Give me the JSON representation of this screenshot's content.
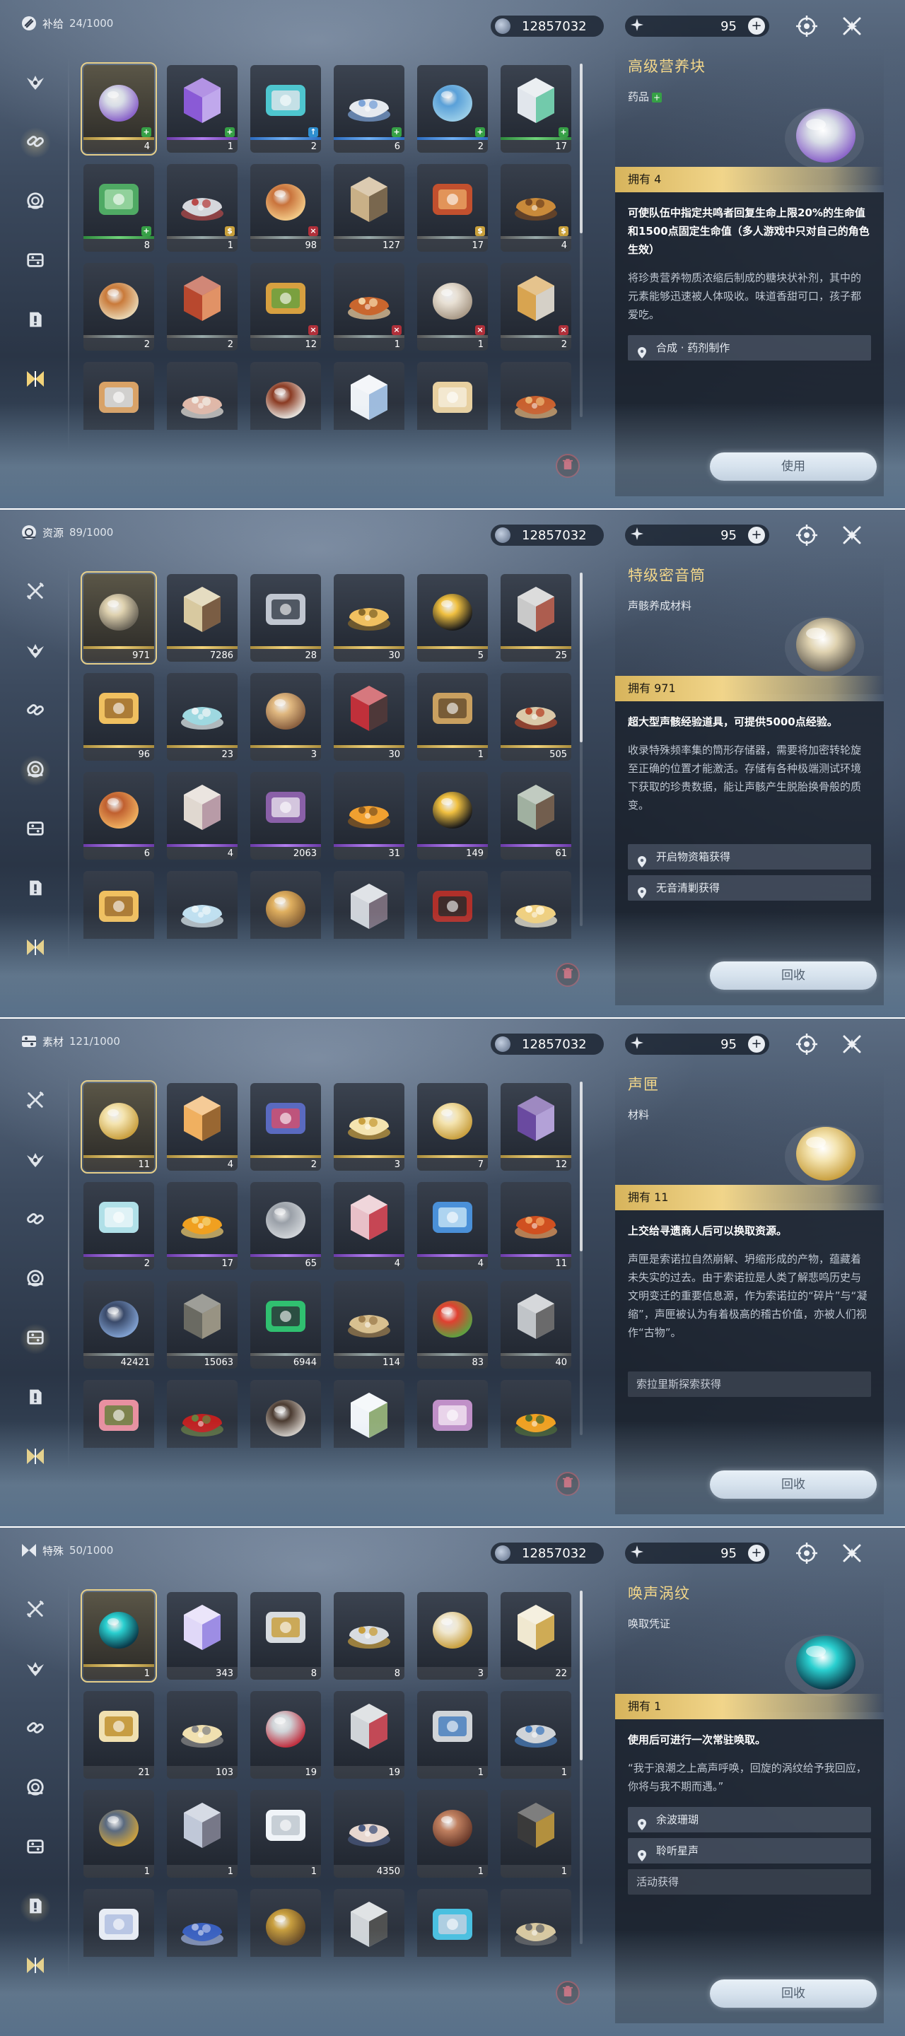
{
  "currency": {
    "coins": "12857032",
    "energy": "95",
    "plus": "+"
  },
  "panels": [
    {
      "category": "补给",
      "count": "24/1000",
      "active_tab": 2,
      "detail": {
        "name": "高级营养块",
        "type": "药品",
        "type_badge": "+",
        "owned": "拥有 4",
        "effect": "可使队伍中指定共鸣者回复生命上限20%的生命值和1500点固定生命值（多人游戏中只对自己的角色生效）",
        "lore": "将珍贵营养物质浓缩后制成的糖块状补剂，其中的元素能够迅速被人体吸收。味道香甜可口，孩子都爱吃。",
        "sources": [
          "合成 · 药剂制作"
        ],
        "plain_sources": [],
        "action": "使用"
      },
      "items": [
        {
          "qty": "4",
          "bar": "gold",
          "badge": "plus",
          "sel": true,
          "c1": "#d8dde6",
          "c2": "#8a63c9"
        },
        {
          "qty": "1",
          "bar": "purple",
          "badge": "plus",
          "c1": "#8a5ad6",
          "c2": "#c9b6f0"
        },
        {
          "qty": "2",
          "bar": "blue",
          "badge": "up",
          "c1": "#4ec6cf",
          "c2": "#d9e4ea"
        },
        {
          "qty": "6",
          "bar": "blue",
          "badge": "plus",
          "c1": "#e5e9ef",
          "c2": "#7da4d8"
        },
        {
          "qty": "2",
          "bar": "blue",
          "badge": "plus",
          "c1": "#5aa0d8",
          "c2": "#99cde8"
        },
        {
          "qty": "17",
          "bar": "green",
          "badge": "plus",
          "c1": "#e1e6ec",
          "c2": "#5ec4a0"
        },
        {
          "qty": "8",
          "bar": "green",
          "badge": "plus",
          "c1": "#4faa64",
          "c2": "#9cd8a4"
        },
        {
          "qty": "1",
          "bar": "gray",
          "badge": "gold",
          "c1": "#d5d7dc",
          "c2": "#b84a4a"
        },
        {
          "qty": "98",
          "bar": "gray",
          "badge": "x",
          "c1": "#c9733c",
          "c2": "#f2c886"
        },
        {
          "qty": "127",
          "bar": "gray",
          "badge": "",
          "c1": "#c9b087",
          "c2": "#6b5a44"
        },
        {
          "qty": "17",
          "bar": "gray",
          "badge": "gold",
          "c1": "#c2502e",
          "c2": "#e8a060"
        },
        {
          "qty": "4",
          "bar": "gray",
          "badge": "gold",
          "c1": "#c98a3a",
          "c2": "#7a4a22"
        },
        {
          "qty": "2",
          "bar": "gray",
          "badge": "",
          "c1": "#c97a3a",
          "c2": "#e8d4b0"
        },
        {
          "qty": "2",
          "bar": "gray",
          "badge": "",
          "c1": "#b8482e",
          "c2": "#e8a070"
        },
        {
          "qty": "12",
          "bar": "gray",
          "badge": "x",
          "c1": "#d7a040",
          "c2": "#6aa040"
        },
        {
          "qty": "1",
          "bar": "gray",
          "badge": "x",
          "c1": "#c9662e",
          "c2": "#f2d0a0"
        },
        {
          "qty": "1",
          "bar": "gray",
          "badge": "x",
          "c1": "#e8e0d4",
          "c2": "#a99a88"
        },
        {
          "qty": "2",
          "bar": "gray",
          "badge": "x",
          "c1": "#d8a450",
          "c2": "#d5d8dc"
        },
        {
          "qty": "",
          "bar": "",
          "badge": "",
          "c1": "#d9a266",
          "c2": "#cfd8e0"
        },
        {
          "qty": "",
          "bar": "",
          "badge": "",
          "c1": "#e0b8a8",
          "c2": "#f0e8e0"
        },
        {
          "qty": "",
          "bar": "",
          "badge": "",
          "c1": "#8a3a22",
          "c2": "#e8e0d8"
        },
        {
          "qty": "",
          "bar": "",
          "badge": "",
          "c1": "#eef2f6",
          "c2": "#8fb2d8"
        },
        {
          "qty": "",
          "bar": "",
          "badge": "",
          "c1": "#e8d0a0",
          "c2": "#f4ecd8"
        },
        {
          "qty": "",
          "bar": "",
          "badge": "",
          "c1": "#c9602e",
          "c2": "#e8b070"
        }
      ]
    },
    {
      "category": "资源",
      "count": "89/1000",
      "active_tab": 3,
      "detail": {
        "name": "特级密音筒",
        "type": "声骸养成材料",
        "type_badge": "",
        "owned": "拥有 971",
        "effect": "超大型声骸经验道具，可提供5000点经验。",
        "lore": "收录特殊频率集的筒形存储器，需要将加密转轮旋至正确的位置才能激活。存储有各种极端测试环境下获取的珍贵数据，能让声骸产生脱胎换骨般的质变。",
        "sources": [
          "开启物资箱获得",
          "无音清剿获得"
        ],
        "plain_sources": [],
        "action": "回收"
      },
      "items": [
        {
          "qty": "971",
          "bar": "gold",
          "badge": "",
          "sel": true,
          "c1": "#dfd2b0",
          "c2": "#6a6458"
        },
        {
          "qty": "7286",
          "bar": "gold",
          "badge": "",
          "c1": "#d8c9a0",
          "c2": "#6a4a34"
        },
        {
          "qty": "28",
          "bar": "gold",
          "badge": "",
          "c1": "#c0c6d0",
          "c2": "#3c4450"
        },
        {
          "qty": "30",
          "bar": "gold",
          "badge": "",
          "c1": "#f0c060",
          "c2": "#8a6a2a"
        },
        {
          "qty": "5",
          "bar": "gold",
          "badge": "",
          "c1": "#f0c040",
          "c2": "#1a1a1a"
        },
        {
          "qty": "25",
          "bar": "gold",
          "badge": "",
          "c1": "#c9c9c9",
          "c2": "#a84a3a"
        },
        {
          "qty": "96",
          "bar": "gold",
          "badge": "",
          "c1": "#f0c060",
          "c2": "#a07030"
        },
        {
          "qty": "23",
          "bar": "gold",
          "badge": "",
          "c1": "#9ed8e0",
          "c2": "#e8f2f4"
        },
        {
          "qty": "3",
          "bar": "gold",
          "badge": "",
          "c1": "#e0b880",
          "c2": "#8a6040"
        },
        {
          "qty": "30",
          "bar": "gold",
          "badge": "",
          "c1": "#c0303a",
          "c2": "#3a3a3a"
        },
        {
          "qty": "1",
          "bar": "gold",
          "badge": "",
          "c1": "#c9a060",
          "c2": "#6a5030"
        },
        {
          "qty": "505",
          "bar": "gold",
          "badge": "",
          "c1": "#dac8a8",
          "c2": "#b84a2e"
        },
        {
          "qty": "6",
          "bar": "purple",
          "badge": "",
          "c1": "#c06030",
          "c2": "#f0b060"
        },
        {
          "qty": "4",
          "bar": "purple",
          "badge": "",
          "c1": "#e0d8d0",
          "c2": "#b090a0"
        },
        {
          "qty": "2063",
          "bar": "purple",
          "badge": "",
          "c1": "#8a60a8",
          "c2": "#e0d8e8"
        },
        {
          "qty": "31",
          "bar": "purple",
          "badge": "",
          "c1": "#f0a030",
          "c2": "#8a5a20"
        },
        {
          "qty": "149",
          "bar": "purple",
          "badge": "",
          "c1": "#f0c040",
          "c2": "#1a1a1a"
        },
        {
          "qty": "61",
          "bar": "purple",
          "badge": "",
          "c1": "#a0b0a0",
          "c2": "#6a5040"
        },
        {
          "qty": "",
          "bar": "",
          "badge": "",
          "c1": "#f0c060",
          "c2": "#a07030"
        },
        {
          "qty": "",
          "bar": "",
          "badge": "",
          "c1": "#c0e0f0",
          "c2": "#e8f4f8"
        },
        {
          "qty": "",
          "bar": "",
          "badge": "",
          "c1": "#e0b060",
          "c2": "#8a6030"
        },
        {
          "qty": "",
          "bar": "",
          "badge": "",
          "c1": "#d0d4da",
          "c2": "#6a5a6a"
        },
        {
          "qty": "",
          "bar": "",
          "badge": "",
          "c1": "#b0302a",
          "c2": "#2a2a2a"
        },
        {
          "qty": "",
          "bar": "",
          "badge": "",
          "c1": "#f0d080",
          "c2": "#fff8e0"
        }
      ]
    },
    {
      "category": "素材",
      "count": "121/1000",
      "active_tab": 4,
      "detail": {
        "name": "声匣",
        "type": "材料",
        "type_badge": "",
        "owned": "拥有 11",
        "effect": "上交给寻遗商人后可以换取资源。",
        "lore": "声匣是索诺拉自然崩解、坍缩形成的产物，蕴藏着未失实的过去。由于索诺拉是人类了解悲鸣历史与文明变迁的重要信息源，作为索诺拉的“碎片”与“凝缩”，声匣被认为有着极高的稽古价值，亦被人们视作“古物”。",
        "sources": [],
        "plain_sources": [
          "索拉里斯探索获得"
        ],
        "action": "回收"
      },
      "items": [
        {
          "qty": "11",
          "bar": "gold",
          "badge": "",
          "sel": true,
          "c1": "#f4e4b0",
          "c2": "#c9a040"
        },
        {
          "qty": "4",
          "bar": "gold",
          "badge": "",
          "c1": "#f0b060",
          "c2": "#8a5a2a"
        },
        {
          "qty": "2",
          "bar": "gold",
          "badge": "",
          "c1": "#5a6ac0",
          "c2": "#d05070"
        },
        {
          "qty": "3",
          "bar": "gold",
          "badge": "",
          "c1": "#f4e4b0",
          "c2": "#c9a040"
        },
        {
          "qty": "7",
          "bar": "gold",
          "badge": "",
          "c1": "#f4e4b0",
          "c2": "#c9a040"
        },
        {
          "qty": "12",
          "bar": "gold",
          "badge": "",
          "c1": "#6a4aa0",
          "c2": "#c0b0e0"
        },
        {
          "qty": "2",
          "bar": "purple",
          "badge": "",
          "c1": "#b0e0e8",
          "c2": "#e8f4f8"
        },
        {
          "qty": "17",
          "bar": "purple",
          "badge": "",
          "c1": "#f0a020",
          "c2": "#f4d070"
        },
        {
          "qty": "65",
          "bar": "purple",
          "badge": "",
          "c1": "#9aa0a8",
          "c2": "#d0d4d8"
        },
        {
          "qty": "4",
          "bar": "purple",
          "badge": "",
          "c1": "#e8c0c8",
          "c2": "#c03040"
        },
        {
          "qty": "4",
          "bar": "purple",
          "badge": "",
          "c1": "#4a90d8",
          "c2": "#c0e0f4"
        },
        {
          "qty": "11",
          "bar": "purple",
          "badge": "",
          "c1": "#d05020",
          "c2": "#f0a060"
        },
        {
          "qty": "42421",
          "bar": "gray",
          "badge": "",
          "c1": "#3a4a6a",
          "c2": "#80a0d0"
        },
        {
          "qty": "15063",
          "bar": "gray",
          "badge": "",
          "c1": "#6a6a62",
          "c2": "#a09a8a"
        },
        {
          "qty": "6944",
          "bar": "gray",
          "badge": "",
          "c1": "#30c070",
          "c2": "#2a3a3a"
        },
        {
          "qty": "114",
          "bar": "gray",
          "badge": "",
          "c1": "#d8c090",
          "c2": "#a08050"
        },
        {
          "qty": "83",
          "bar": "gray",
          "badge": "",
          "c1": "#e04030",
          "c2": "#60a040"
        },
        {
          "qty": "40",
          "bar": "gray",
          "badge": "",
          "c1": "#c0c4c8",
          "c2": "#5a5a5a"
        },
        {
          "qty": "",
          "bar": "",
          "badge": "",
          "c1": "#e890a0",
          "c2": "#6a8040"
        },
        {
          "qty": "",
          "bar": "",
          "badge": "",
          "c1": "#c02020",
          "c2": "#6a8040"
        },
        {
          "qty": "",
          "bar": "",
          "badge": "",
          "c1": "#4a3a30",
          "c2": "#d0c8c0"
        },
        {
          "qty": "",
          "bar": "",
          "badge": "",
          "c1": "#f0f4f8",
          "c2": "#80a060"
        },
        {
          "qty": "",
          "bar": "",
          "badge": "",
          "c1": "#c090c8",
          "c2": "#f0e0f0"
        },
        {
          "qty": "",
          "bar": "",
          "badge": "",
          "c1": "#f0a020",
          "c2": "#4a6a30"
        }
      ]
    },
    {
      "category": "特殊",
      "count": "50/1000",
      "active_tab": 5,
      "detail": {
        "name": "唤声涡纹",
        "type": "唤取凭证",
        "type_badge": "",
        "owned": "拥有 1",
        "effect": "使用后可进行一次常驻唤取。",
        "lore": "“我于浪潮之上高声呼唤，回旋的涡纹给予我回应，你将与我不期而遇。”",
        "sources": [
          "余波珊瑚",
          "聆听星声"
        ],
        "plain_sources": [
          "活动获得"
        ],
        "action": "回收"
      },
      "items": [
        {
          "qty": "1",
          "bar": "gold",
          "badge": "",
          "sel": true,
          "c1": "#2ad0d0",
          "c2": "#0a3a4a"
        },
        {
          "qty": "343",
          "bar": "",
          "badge": "",
          "c1": "#e0d8f8",
          "c2": "#9080e0"
        },
        {
          "qty": "8",
          "bar": "",
          "badge": "",
          "c1": "#d8dce0",
          "c2": "#c9a040"
        },
        {
          "qty": "8",
          "bar": "",
          "badge": "",
          "c1": "#d8dce0",
          "c2": "#c9a040"
        },
        {
          "qty": "3",
          "bar": "",
          "badge": "",
          "c1": "#f0e8d0",
          "c2": "#c9a040"
        },
        {
          "qty": "22",
          "bar": "",
          "badge": "",
          "c1": "#f0e8d0",
          "c2": "#c9a040"
        },
        {
          "qty": "21",
          "bar": "",
          "badge": "",
          "c1": "#f0e0b0",
          "c2": "#c09030"
        },
        {
          "qty": "103",
          "bar": "",
          "badge": "",
          "c1": "#f0e0b0",
          "c2": "#8a8a8a"
        },
        {
          "qty": "19",
          "bar": "",
          "badge": "",
          "c1": "#d0d4d8",
          "c2": "#c03040"
        },
        {
          "qty": "19",
          "bar": "",
          "badge": "",
          "c1": "#d0d4d8",
          "c2": "#c03040"
        },
        {
          "qty": "1",
          "bar": "",
          "badge": "",
          "c1": "#d0d4d8",
          "c2": "#4a80c0"
        },
        {
          "qty": "1",
          "bar": "",
          "badge": "",
          "c1": "#d0d4d8",
          "c2": "#4a80c0"
        },
        {
          "qty": "1",
          "bar": "",
          "badge": "",
          "c1": "#5a6a80",
          "c2": "#c9a040"
        },
        {
          "qty": "1",
          "bar": "",
          "badge": "",
          "c1": "#c0c8d8",
          "c2": "#6a6a7a"
        },
        {
          "qty": "1",
          "bar": "",
          "badge": "",
          "c1": "#f0f4f8",
          "c2": "#c0c8d0"
        },
        {
          "qty": "4350",
          "bar": "",
          "badge": "",
          "c1": "#e8d8d0",
          "c2": "#4a5a80"
        },
        {
          "qty": "1",
          "bar": "",
          "badge": "",
          "c1": "#c08060",
          "c2": "#6a3a2a"
        },
        {
          "qty": "1",
          "bar": "",
          "badge": "",
          "c1": "#3a3a3a",
          "c2": "#c9a040"
        },
        {
          "qty": "",
          "bar": "",
          "badge": "",
          "c1": "#e8ecf4",
          "c2": "#b0c0e0"
        },
        {
          "qty": "",
          "bar": "",
          "badge": "",
          "c1": "#3a60c0",
          "c2": "#a0b0e0"
        },
        {
          "qty": "",
          "bar": "",
          "badge": "",
          "c1": "#c9a040",
          "c2": "#6a4a20"
        },
        {
          "qty": "",
          "bar": "",
          "badge": "",
          "c1": "#d0d4d8",
          "c2": "#3a3a3a"
        },
        {
          "qty": "",
          "bar": "",
          "badge": "",
          "c1": "#4ac0e0",
          "c2": "#c0d0e0"
        },
        {
          "qty": "",
          "bar": "",
          "badge": "",
          "c1": "#d8c8a0",
          "c2": "#6a6a6a"
        }
      ]
    }
  ],
  "icons": {
    "coin": "coin-icon",
    "energy": "energy-icon",
    "target": "target-icon",
    "close": "close-icon",
    "sidebar": [
      "crossed-swords-icon",
      "phoenix-icon",
      "chain-icon",
      "echo-icon",
      "material-icon",
      "document-icon",
      "special-icon"
    ],
    "trash": "trash-icon",
    "pin": "location-pin-icon"
  }
}
